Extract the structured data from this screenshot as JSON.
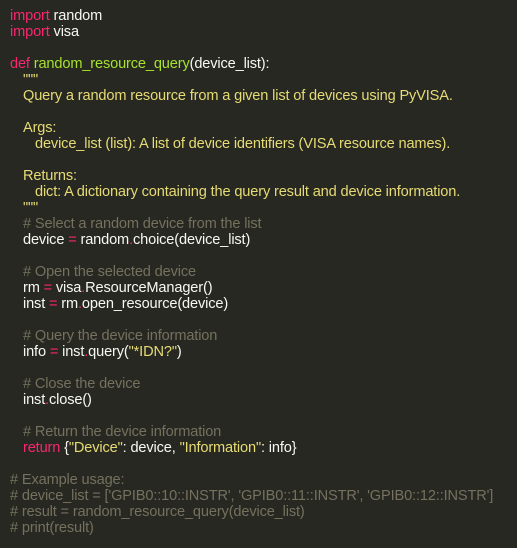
{
  "code": {
    "l01": {
      "kw": "import",
      "rest": " random"
    },
    "l02": {
      "kw": "import",
      "rest": " visa"
    },
    "l04": {
      "kw": "def",
      "fn": "random_resource_query",
      "rest": "(device_list):"
    },
    "l05": "\"\"\"",
    "l06": "Query a random resource from a given list of devices using PyVISA.",
    "l08": "Args:",
    "l09": "device_list (list): A list of device identifiers (VISA resource names).",
    "l11": "Returns:",
    "l12": "dict: A dictionary containing the query result and device information.",
    "l13": "\"\"\"",
    "l14": "# Select a random device from the list",
    "l15": {
      "a": "device ",
      "op": "=",
      "b": " random",
      "dot": ".",
      "c": "choice(device_list)"
    },
    "l17": "# Open the selected device",
    "l18": {
      "a": "rm ",
      "op": "=",
      "b": " visa",
      "dot": ".",
      "c": "ResourceManager()"
    },
    "l19": {
      "a": "inst ",
      "op": "=",
      "b": " rm",
      "dot": ".",
      "c": "open_resource(device)"
    },
    "l21": "# Query the device information",
    "l22": {
      "a": "info ",
      "op": "=",
      "b": " inst",
      "dot": ".",
      "c": "query(",
      "str": "\"*IDN?\"",
      "d": ")"
    },
    "l24": "# Close the device",
    "l25": {
      "a": "inst",
      "dot": ".",
      "c": "close()"
    },
    "l27": "# Return the device information",
    "l28": {
      "kw": "return",
      "a": " {",
      "s1": "\"Device\"",
      "b": ": device, ",
      "s2": "\"Information\"",
      "c": ": info}"
    },
    "l30": "# Example usage:",
    "l31": "# device_list = ['GPIB0::10::INSTR', 'GPIB0::11::INSTR', 'GPIB0::12::INSTR']",
    "l32": "# result = random_resource_query(device_list)",
    "l33": "# print(result)"
  },
  "colors": {
    "background": "#272822",
    "keyword": "#f92672",
    "function": "#a6e22e",
    "string": "#e6db74",
    "comment": "#75715e",
    "text": "#f8f8f2"
  }
}
